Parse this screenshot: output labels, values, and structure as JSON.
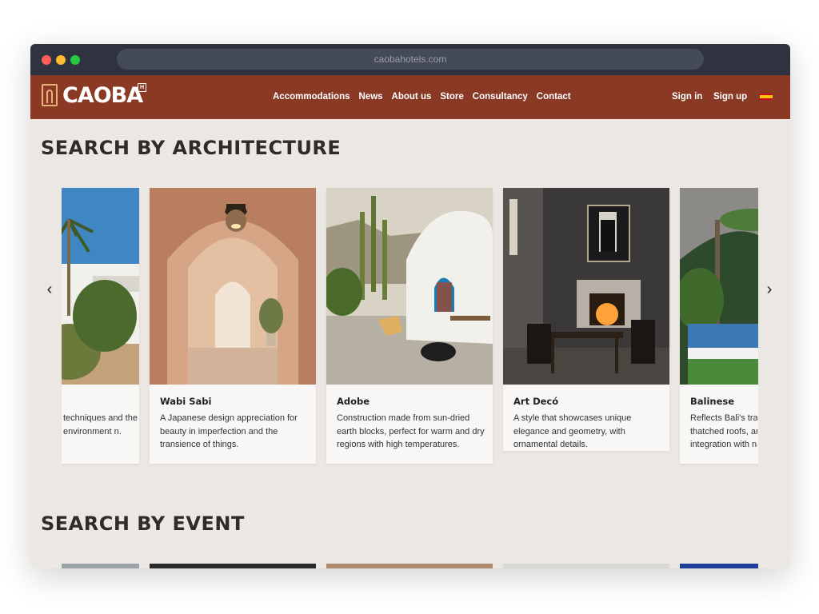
{
  "browser": {
    "url": "caobahotels.com"
  },
  "nav": {
    "logo_text": "CAOBA",
    "logo_badge": "H",
    "links": [
      "Accommodations",
      "News",
      "About us",
      "Store",
      "Consultancy",
      "Contact"
    ],
    "sign_in": "Sign in",
    "sign_up": "Sign up",
    "language_flag": "spain-flag-icon"
  },
  "architecture": {
    "title": "SEARCH BY ARCHITECTURE",
    "cards": [
      {
        "title": "",
        "desc": "techniques and the environment n."
      },
      {
        "title": "Wabi Sabi",
        "desc": "A Japanese design appreciation for beauty in imperfection and the transience of things."
      },
      {
        "title": "Adobe",
        "desc": "Construction made from sun-dried earth blocks, perfect for warm and dry regions with high temperatures."
      },
      {
        "title": "Art Decó",
        "desc": "A style that showcases unique elegance and geometry, with ornamental details."
      },
      {
        "title": "Balinese",
        "desc": "Reflects Bali's trad thatched roofs, and integration with nat"
      }
    ],
    "prev_icon": "chevron-left-icon",
    "next_icon": "chevron-right-icon"
  },
  "event": {
    "title": "SEARCH BY EVENT"
  },
  "colors": {
    "nav_bg": "#8a3a24",
    "page_bg": "#ebe8e3",
    "titlebar_bg": "#2f3340"
  }
}
